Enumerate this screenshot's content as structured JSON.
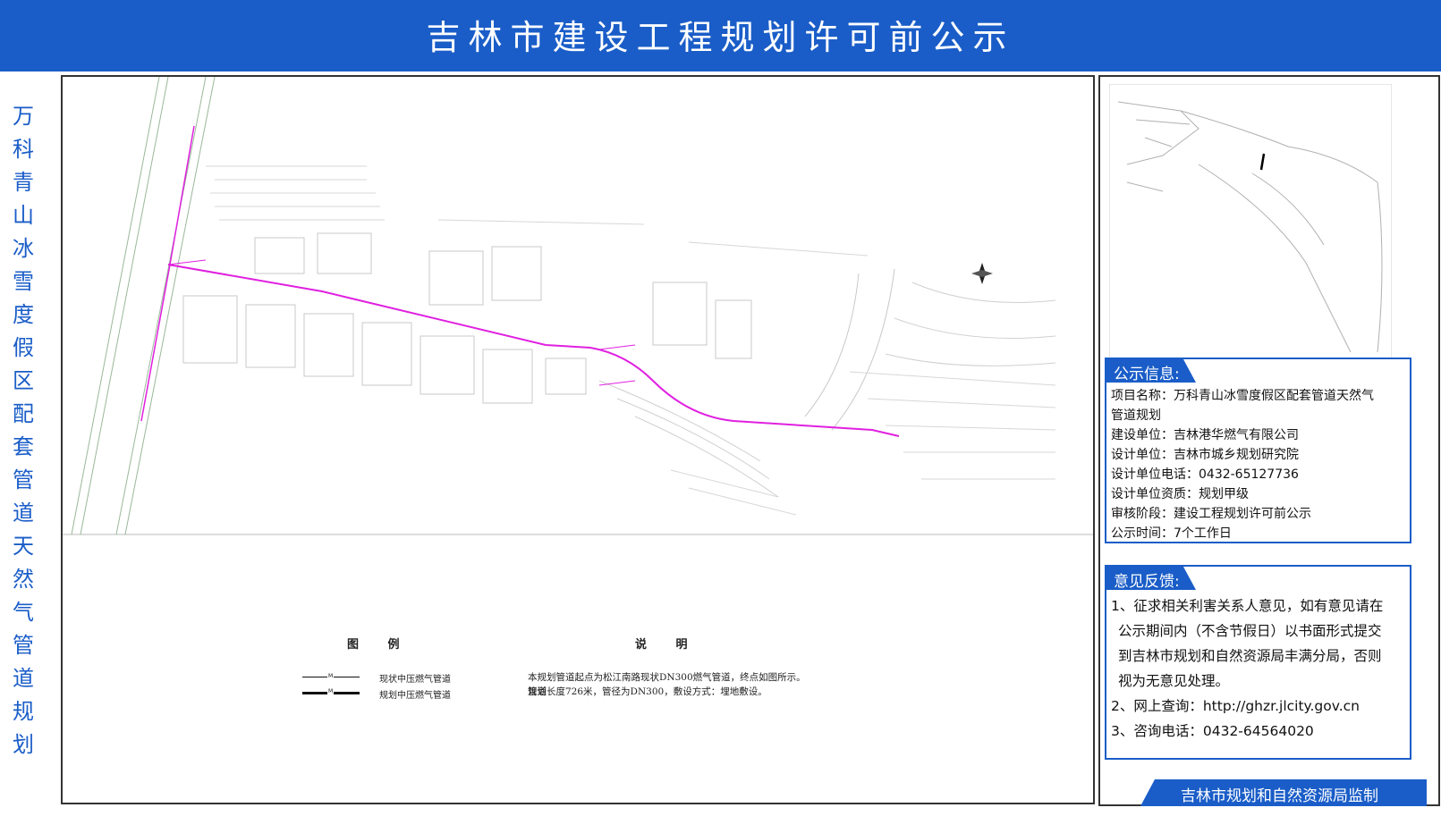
{
  "banner": {
    "title": "吉林市建设工程规划许可前公示"
  },
  "side_title": [
    "万",
    "科",
    "青",
    "山",
    "冰",
    "雪",
    "度",
    "假",
    "区",
    "配",
    "套",
    "管",
    "道",
    "天",
    "然",
    "气",
    "管",
    "道",
    "规",
    "划"
  ],
  "legend": {
    "title": "图 例",
    "existing": "现状中压燃气管道",
    "planned": "规划中压燃气管道",
    "mark": "M"
  },
  "notes": {
    "title": "说 明",
    "line1": "本规划管道起点为松江南路现状DN300燃气管道，终点如图所示。规划",
    "line2": "管道长度726米，管径为DN300，敷设方式：埋地敷设。"
  },
  "publicity": {
    "heading": "公示信息:",
    "project_line1": "项目名称：万科青山冰雪度假区配套管道天然气",
    "project_line2": "管道规划",
    "builder": "建设单位：吉林港华燃气有限公司",
    "designer": "设计单位：吉林市城乡规划研究院",
    "phone": "设计单位电话：0432-65127736",
    "qualification": "设计单位资质：规划甲级",
    "stage": "审核阶段：建设工程规划许可前公示",
    "period": "公示时间：7个工作日"
  },
  "feedback": {
    "heading": "意见反馈:",
    "item1_line1": "1、征求相关利害关系人意见，如有意见请在",
    "item1_line2": "公示期间内（不含节假日）以书面形式提交",
    "item1_line3": "到吉林市规划和自然资源局丰满分局，否则",
    "item1_line4": "视为无意见处理。",
    "item2": "2、网上查询：http://ghzr.jlcity.gov.cn",
    "item3": "3、咨询电话：0432-64564020"
  },
  "footer": {
    "supervisor": "吉林市规划和自然资源局监制"
  },
  "colors": {
    "brand_blue": "#1a5dc8",
    "pipeline": "#e020e0",
    "map_lines": "#c8c8c8"
  }
}
